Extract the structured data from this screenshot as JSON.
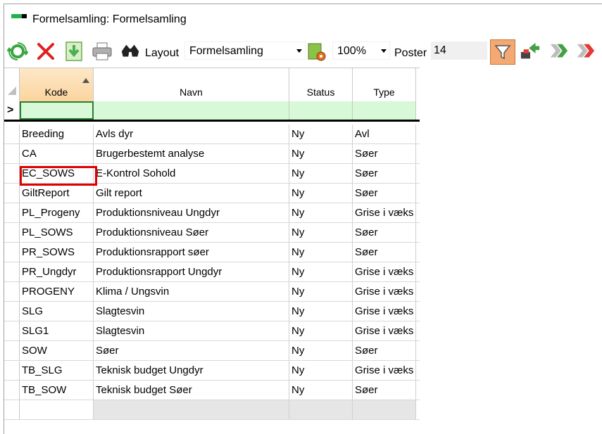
{
  "window": {
    "title": "Formelsamling: Formelsamling"
  },
  "toolbar": {
    "refresh_icon": "refresh-icon",
    "delete_icon": "delete-icon",
    "export_icon": "export-icon",
    "print_icon": "print-icon",
    "search_icon": "binoculars-icon",
    "layout_label": "Layout",
    "layout_value": "Formelsamling",
    "zoom_value": "100%",
    "poster_label": "Poster",
    "poster_count": "14"
  },
  "grid": {
    "columns": [
      "Kode",
      "Navn",
      "Status",
      "Type"
    ],
    "sorted_column": "Kode",
    "new_row_marker": ">",
    "rows": [
      [
        "Breeding",
        "Avls dyr",
        "Ny",
        "Avl"
      ],
      [
        "CA",
        "Brugerbestemt analyse",
        "Ny",
        "Søer"
      ],
      [
        "EC_SOWS",
        "E-Kontrol Sohold",
        "Ny",
        "Søer"
      ],
      [
        "GiltReport",
        "Gilt report",
        "Ny",
        "Søer"
      ],
      [
        "PL_Progeny",
        "Produktionsniveau Ungdyr",
        "Ny",
        "Grise i væks"
      ],
      [
        "PL_SOWS",
        "Produktionsniveau Søer",
        "Ny",
        "Søer"
      ],
      [
        "PR_SOWS",
        "Produktionsrapport søer",
        "Ny",
        "Søer"
      ],
      [
        "PR_Ungdyr",
        "Produktionsrapport Ungdyr",
        "Ny",
        "Grise i væks"
      ],
      [
        "PROGENY",
        "Klima / Ungsvin",
        "Ny",
        "Grise i væks"
      ],
      [
        "SLG",
        "Slagtesvin",
        "Ny",
        "Grise i væks"
      ],
      [
        "SLG1",
        "Slagtesvin",
        "Ny",
        "Grise i væks"
      ],
      [
        "SOW",
        "Søer",
        "Ny",
        "Søer"
      ],
      [
        "TB_SLG",
        "Teknisk budget Ungdyr",
        "Ny",
        "Grise i væks"
      ],
      [
        "TB_SOW",
        "Teknisk budget Søer",
        "Ny",
        "Søer"
      ]
    ],
    "highlighted_cell": "EC_SOWS"
  }
}
